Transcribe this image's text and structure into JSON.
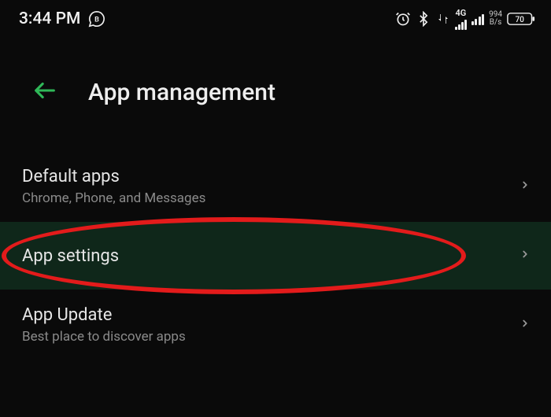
{
  "status": {
    "time": "3:44 PM",
    "network_label": "4G",
    "speed_value": "994",
    "speed_unit": "B/s",
    "battery": "70"
  },
  "header": {
    "title": "App management"
  },
  "items": [
    {
      "title": "Default apps",
      "subtitle": "Chrome, Phone, and Messages"
    },
    {
      "title": "App settings",
      "subtitle": ""
    },
    {
      "title": "App Update",
      "subtitle": "Best place to discover apps"
    }
  ]
}
